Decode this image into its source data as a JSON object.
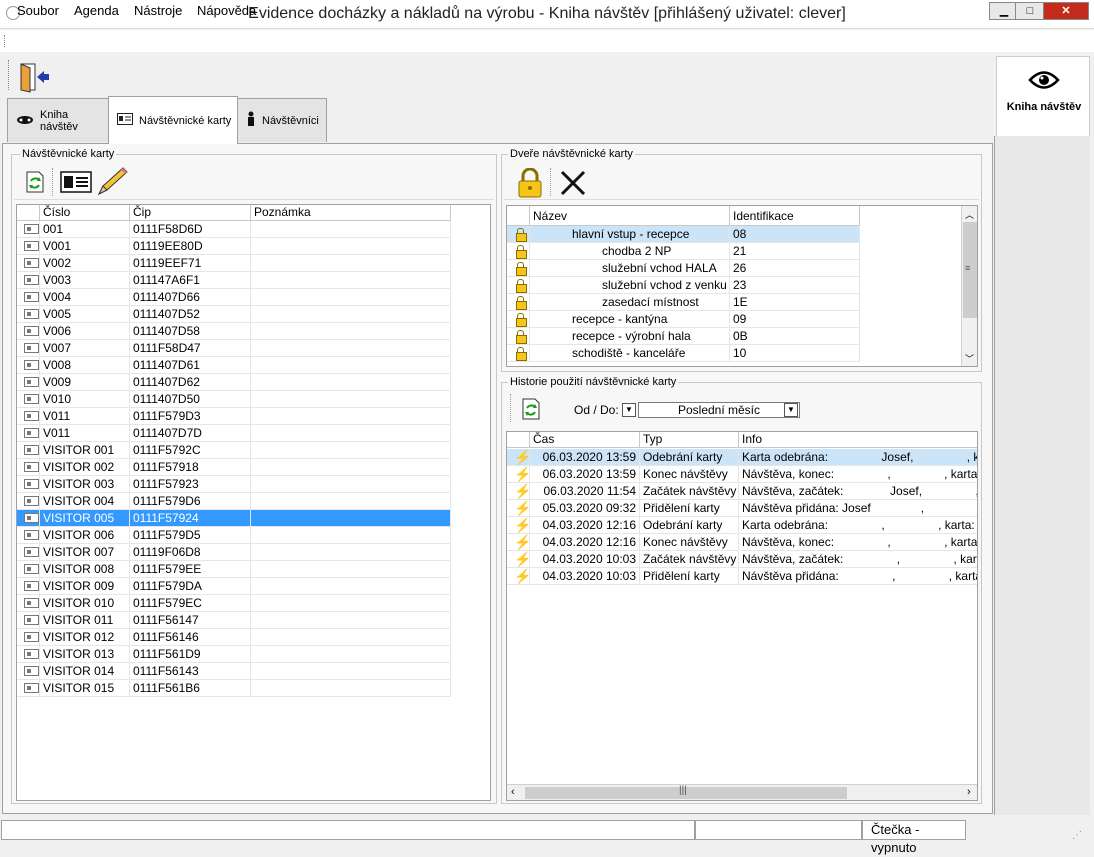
{
  "window": {
    "title": "Evidence docházky a nákladů na výrobu - Kniha návštěv [přihlášený uživatel: clever]",
    "min": "▁",
    "max": "□",
    "close": "✕"
  },
  "menu": [
    "Soubor",
    "Agenda",
    "Nástroje",
    "Nápověda"
  ],
  "tabs": [
    "Kniha návštěv",
    "Návštěvnické karty",
    "Návštěvníci"
  ],
  "right_nav": {
    "label": "Kniha návštěv",
    "icon": "eye-icon"
  },
  "cards_panel": {
    "title": "Návštěvnické karty",
    "columns": [
      "Číslo",
      "Čip",
      "Poznámka"
    ],
    "rows": [
      {
        "cislo": "001",
        "cip": "0111F58D6D",
        "poznamka": ""
      },
      {
        "cislo": "V001",
        "cip": "01119EE80D",
        "poznamka": ""
      },
      {
        "cislo": "V002",
        "cip": "01119EEF71",
        "poznamka": ""
      },
      {
        "cislo": "V003",
        "cip": "011147A6F1",
        "poznamka": ""
      },
      {
        "cislo": "V004",
        "cip": "0111407D66",
        "poznamka": ""
      },
      {
        "cislo": "V005",
        "cip": "0111407D52",
        "poznamka": ""
      },
      {
        "cislo": "V006",
        "cip": "0111407D58",
        "poznamka": ""
      },
      {
        "cislo": "V007",
        "cip": "0111F58D47",
        "poznamka": ""
      },
      {
        "cislo": "V008",
        "cip": "0111407D61",
        "poznamka": ""
      },
      {
        "cislo": "V009",
        "cip": "0111407D62",
        "poznamka": ""
      },
      {
        "cislo": "V010",
        "cip": "0111407D50",
        "poznamka": ""
      },
      {
        "cislo": "V011",
        "cip": "0111F579D3",
        "poznamka": ""
      },
      {
        "cislo": "V011",
        "cip": "0111407D7D",
        "poznamka": ""
      },
      {
        "cislo": "VISITOR 001",
        "cip": "0111F5792C",
        "poznamka": ""
      },
      {
        "cislo": "VISITOR 002",
        "cip": "0111F57918",
        "poznamka": ""
      },
      {
        "cislo": "VISITOR 003",
        "cip": "0111F57923",
        "poznamka": ""
      },
      {
        "cislo": "VISITOR 004",
        "cip": "0111F579D6",
        "poznamka": ""
      },
      {
        "cislo": "VISITOR 005",
        "cip": "0111F57924",
        "poznamka": ""
      },
      {
        "cislo": "VISITOR 006",
        "cip": "0111F579D5",
        "poznamka": ""
      },
      {
        "cislo": "VISITOR 007",
        "cip": "01119F06D8",
        "poznamka": ""
      },
      {
        "cislo": "VISITOR 008",
        "cip": "0111F579EE",
        "poznamka": ""
      },
      {
        "cislo": "VISITOR 009",
        "cip": "0111F579DA",
        "poznamka": ""
      },
      {
        "cislo": "VISITOR 010",
        "cip": "0111F579EC",
        "poznamka": ""
      },
      {
        "cislo": "VISITOR 011",
        "cip": "0111F56147",
        "poznamka": ""
      },
      {
        "cislo": "VISITOR 012",
        "cip": "0111F56146",
        "poznamka": ""
      },
      {
        "cislo": "VISITOR 013",
        "cip": "0111F561D9",
        "poznamka": ""
      },
      {
        "cislo": "VISITOR 014",
        "cip": "0111F56143",
        "poznamka": ""
      },
      {
        "cislo": "VISITOR 015",
        "cip": "0111F561B6",
        "poznamka": ""
      }
    ],
    "selected_index": 17
  },
  "doors_panel": {
    "title": "Dveře návštěvnické karty",
    "columns": [
      "Název",
      "Identifikace"
    ],
    "rows": [
      {
        "nazev": "hlavní vstup - recepce",
        "id": "08",
        "indent": 1
      },
      {
        "nazev": "chodba 2 NP",
        "id": "21",
        "indent": 2
      },
      {
        "nazev": "služební vchod HALA",
        "id": "26",
        "indent": 2
      },
      {
        "nazev": "služební vchod z venku",
        "id": "23",
        "indent": 2
      },
      {
        "nazev": "zasedací místnost",
        "id": "1E",
        "indent": 2
      },
      {
        "nazev": "recepce - kantýna",
        "id": "09",
        "indent": 1
      },
      {
        "nazev": "recepce - výrobní hala",
        "id": "0B",
        "indent": 1
      },
      {
        "nazev": "schodiště - kanceláře",
        "id": "10",
        "indent": 1
      }
    ]
  },
  "history_panel": {
    "title": "Historie použití návštěvnické karty",
    "range_label": "Od / Do:",
    "range_value": "Poslední měsíc",
    "columns": [
      "Čas",
      "Typ",
      "Info"
    ],
    "rows": [
      {
        "cas": "06.03.2020 13:59",
        "typ": "Odebrání karty",
        "info": "Karta odebrána:                Josef,                , karta:"
      },
      {
        "cas": "06.03.2020 13:59",
        "typ": "Konec návštěvy",
        "info": "Návštěva, konec:                ,                , karta"
      },
      {
        "cas": "06.03.2020 11:54",
        "typ": "Začátek návštěvy",
        "info": "Návštěva, začátek:              Josef,                , ka"
      },
      {
        "cas": "05.03.2020 09:32",
        "typ": "Přidělení karty",
        "info": "Návštěva přidána: Josef               ,                , kart"
      },
      {
        "cas": "04.03.2020 12:16",
        "typ": "Odebrání karty",
        "info": "Karta odebrána:                ,                , karta: [VIS"
      },
      {
        "cas": "04.03.2020 12:16",
        "typ": "Konec návštěvy",
        "info": "Návštěva, konec:                ,                , karta: [V"
      },
      {
        "cas": "04.03.2020 10:03",
        "typ": "Začátek návštěvy",
        "info": "Návštěva, začátek:                ,                , karta: ["
      },
      {
        "cas": "04.03.2020 10:03",
        "typ": "Přidělení karty",
        "info": "Návštěva přidána:                ,                , karta: [V"
      }
    ]
  },
  "status": {
    "reader": "Čtečka - vypnuto"
  }
}
